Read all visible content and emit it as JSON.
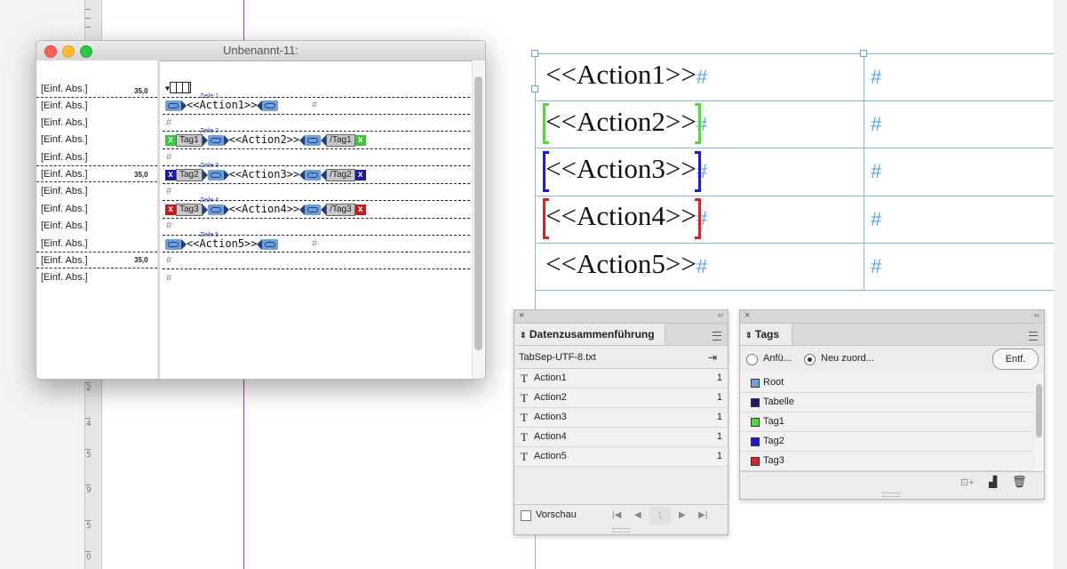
{
  "ruler": {
    "numbers": [
      "2",
      "4",
      "5",
      "9",
      "5",
      "0"
    ]
  },
  "page_table": {
    "rows": [
      {
        "text": "<<Action1>>",
        "hash": "#",
        "hash2": "#",
        "bracket": ""
      },
      {
        "text": "<<Action2>>",
        "hash": "#",
        "hash2": "#",
        "bracket": "#4ddc3d"
      },
      {
        "text": "<<Action3>>",
        "hash": "#",
        "hash2": "#",
        "bracket": "#1a1adb"
      },
      {
        "text": "<<Action4>>",
        "hash": "#",
        "hash2": "#",
        "bracket": "#e02020"
      },
      {
        "text": "<<Action5>>",
        "hash": "#",
        "hash2": "#",
        "bracket": ""
      }
    ]
  },
  "story_editor": {
    "title": "Unbenannt-11:",
    "labels": [
      "[Einf. Abs.]",
      "[Einf. Abs.]",
      "[Einf. Abs.]",
      "[Einf. Abs.]",
      "[Einf. Abs.]",
      "[Einf. Abs.]",
      "[Einf. Abs.]",
      "[Einf. Abs.]",
      "[Einf. Abs.]",
      "[Einf. Abs.]",
      "[Einf. Abs.]",
      "[Einf. Abs.]"
    ],
    "depth_value": "35,0",
    "hash": "#",
    "zeile_labels": [
      "Zeile 1",
      "Zeile 2",
      "Zeile 3",
      "Zeile 4",
      "Zeile 5"
    ],
    "actions": [
      "<<Action1>>",
      "<<Action2>>",
      "<<Action3>>",
      "<<Action4>>",
      "<<Action5>>"
    ],
    "tags": [
      {
        "name": "Tag1",
        "close": "/Tag1",
        "color": "#3cc63c"
      },
      {
        "name": "Tag2",
        "close": "/Tag2",
        "color": "#1a1aa8"
      },
      {
        "name": "Tag3",
        "close": "/Tag3",
        "color": "#c81a1a"
      }
    ]
  },
  "data_merge_panel": {
    "tab": "Datenzusammenführung",
    "source_file": "TabSep-UTF-8.txt",
    "fields": [
      {
        "name": "Action1",
        "count": "1"
      },
      {
        "name": "Action2",
        "count": "1"
      },
      {
        "name": "Action3",
        "count": "1"
      },
      {
        "name": "Action4",
        "count": "1"
      },
      {
        "name": "Action5",
        "count": "1"
      }
    ],
    "preview_label": "Vorschau",
    "record_number": "1"
  },
  "tags_panel": {
    "tab": "Tags",
    "radio_add": "Anfü...",
    "radio_retag": "Neu zuord...",
    "remove_button": "Entf.",
    "tags": [
      {
        "name": "Root",
        "color": "#6ea0de"
      },
      {
        "name": "Tabelle",
        "color": "#1a1a66"
      },
      {
        "name": "Tag1",
        "color": "#4ddc3d"
      },
      {
        "name": "Tag2",
        "color": "#1a1adb"
      },
      {
        "name": "Tag3",
        "color": "#e02020"
      }
    ]
  }
}
